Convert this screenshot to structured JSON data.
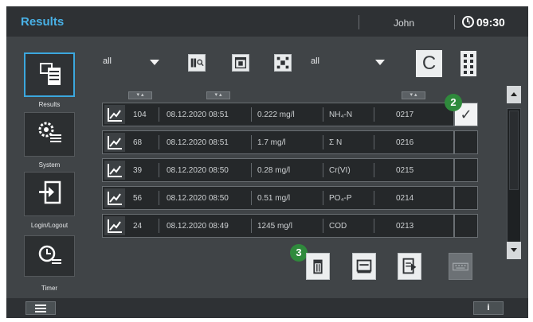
{
  "header": {
    "title": "Results",
    "user": "John",
    "time": "09:30"
  },
  "sidebar": {
    "items": [
      {
        "label": "Results",
        "icon": "results-icon",
        "active": true
      },
      {
        "label": "System",
        "icon": "system-gear-icon",
        "active": false
      },
      {
        "label": "Login/Logout",
        "icon": "login-logout-icon",
        "active": false
      },
      {
        "label": "Timer",
        "icon": "timer-icon",
        "active": false
      }
    ]
  },
  "toolbar": {
    "filter1_value": "all",
    "filter2_value": "all",
    "clear_label": "C",
    "icons": [
      "sample-id-filter-icon",
      "date-filter-icon",
      "parameter-id-filter-icon",
      "column-settings-icon"
    ]
  },
  "table": {
    "rows": [
      {
        "id": "104",
        "datetime": "08.12.2020 08:51",
        "value": "0.222 mg/l",
        "parameter": "NH₄-N",
        "code": "0217",
        "checked": true
      },
      {
        "id": "68",
        "datetime": "08.12.2020 08:51",
        "value": "1.7 mg/l",
        "parameter": "Σ N",
        "code": "0216",
        "checked": false
      },
      {
        "id": "39",
        "datetime": "08.12.2020 08:50",
        "value": "0.28 mg/l",
        "parameter": "Cr(VI)",
        "code": "0215",
        "checked": false
      },
      {
        "id": "56",
        "datetime": "08.12.2020 08:50",
        "value": "0.51 mg/l",
        "parameter": "PO₄-P",
        "code": "0214",
        "checked": false
      },
      {
        "id": "24",
        "datetime": "08.12.2020 08:49",
        "value": "1245 mg/l",
        "parameter": "COD",
        "code": "0213",
        "checked": false
      }
    ]
  },
  "actions": [
    "delete-icon",
    "print-icon",
    "export-icon",
    "keyboard-icon"
  ],
  "badges": {
    "checkbox_marker": "2",
    "delete_marker": "3"
  },
  "footer": {
    "info_label": "i"
  },
  "colors": {
    "accent": "#49b1e6",
    "badge": "#2f8a3c",
    "background": "#404447",
    "row": "#25282a"
  }
}
